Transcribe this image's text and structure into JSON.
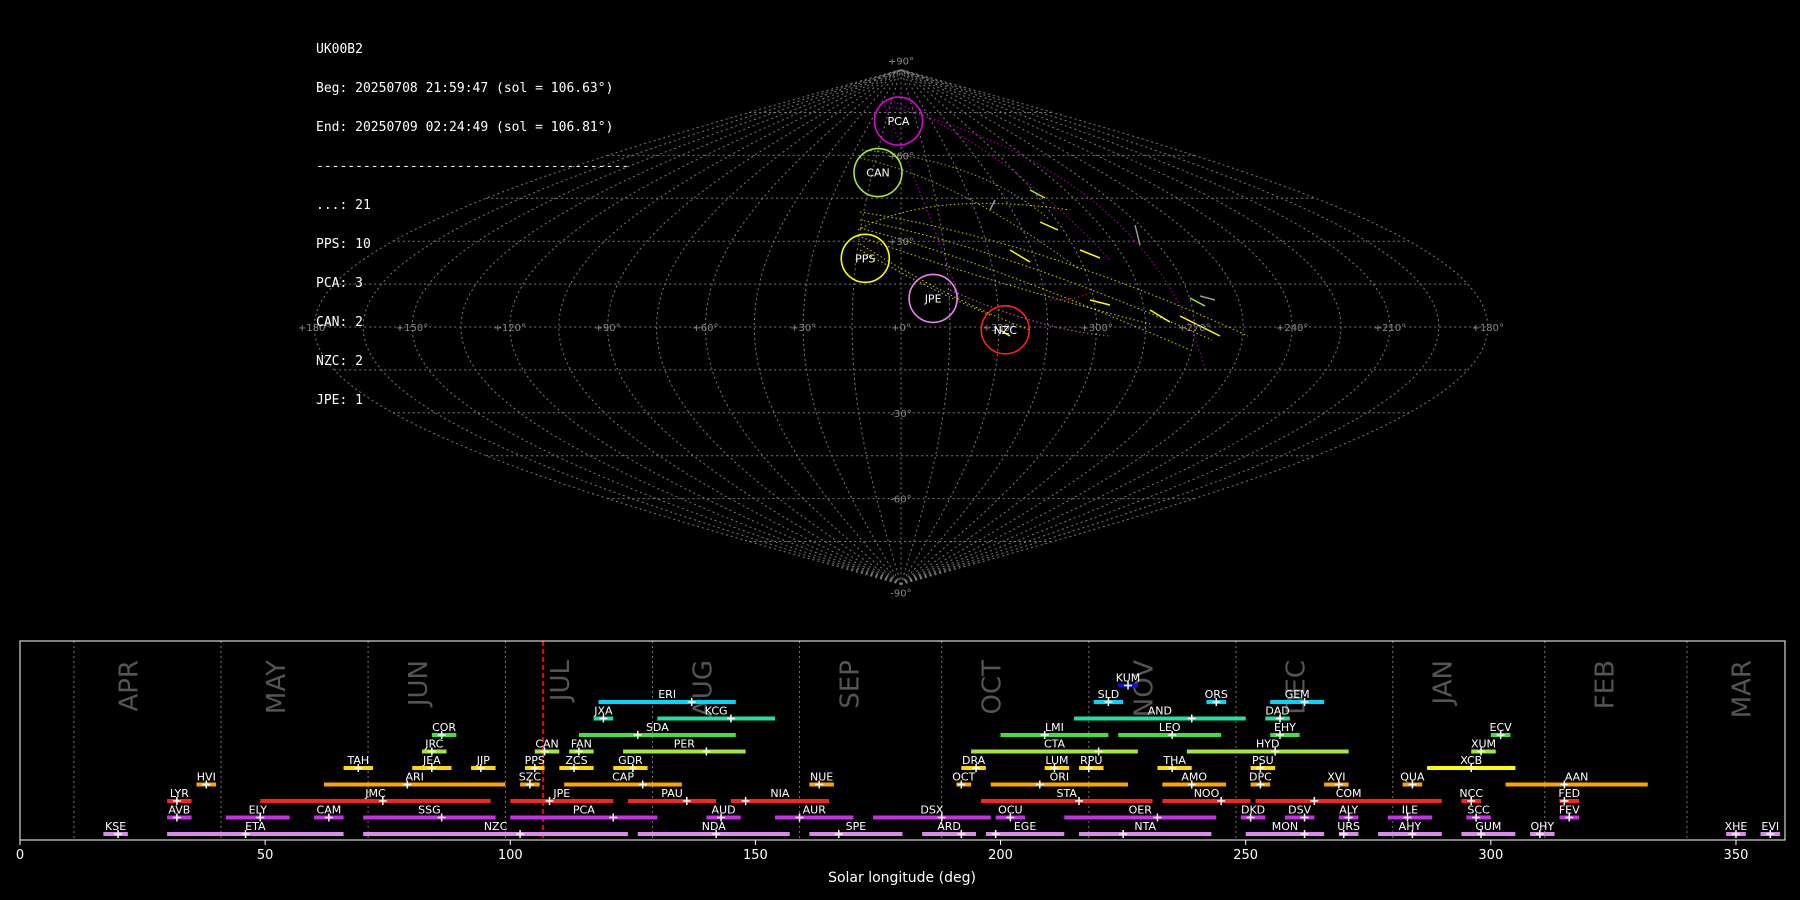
{
  "info": {
    "camera": "UK00B2",
    "beg": "Beg: 20250708 21:59:47 (sol = 106.63°)",
    "end": "End: 20250709 02:24:49 (sol = 106.81°)",
    "divider": "----------------------------------------",
    "counts": [
      "...: 21",
      "PPS: 10",
      "PCA: 3",
      "CAN: 2",
      "NZC: 2",
      "JPE: 1"
    ]
  },
  "sky_map": {
    "projection": "sinusoidal",
    "lon_labels": [
      "+180°",
      "+150°",
      "+120°",
      "+90°",
      "+60°",
      "+30°",
      "+0°",
      "+330°",
      "+300°",
      "+270°",
      "+240°",
      "+210°",
      "+180°"
    ],
    "lat_labels": [
      "+90°",
      "+60°",
      "+30°",
      "-30°",
      "-60°",
      "-90°"
    ],
    "radiants": [
      {
        "code": "PCA",
        "color": "#e000e0",
        "x": -2.5,
        "y": 72
      },
      {
        "code": "CAN",
        "color": "#a4e640",
        "x": -12,
        "y": 54
      },
      {
        "code": "PPS",
        "color": "#ffff00",
        "x": -12,
        "y": 24
      },
      {
        "code": "JPE",
        "color": "#ee82ee",
        "x": 10,
        "y": 10
      },
      {
        "code": "NZC",
        "color": "#ff2020",
        "x": 32,
        "y": -1
      }
    ]
  },
  "chart_data": {
    "type": "timeline",
    "xlabel": "Solar longitude (deg)",
    "xlim": [
      0,
      360
    ],
    "xticks": [
      0,
      50,
      100,
      150,
      200,
      250,
      300,
      350
    ],
    "current_sol": 106.7,
    "months": [
      {
        "label": "APR",
        "at": 24,
        "line": 11
      },
      {
        "label": "MAY",
        "at": 54,
        "line": 41
      },
      {
        "label": "JUN",
        "at": 83,
        "line": 71
      },
      {
        "label": "JUL",
        "at": 112,
        "line": 99
      },
      {
        "label": "AUG",
        "at": 141,
        "line": 129
      },
      {
        "label": "SEP",
        "at": 171,
        "line": 159
      },
      {
        "label": "OCT",
        "at": 200,
        "line": 188
      },
      {
        "label": "NOV",
        "at": 231,
        "line": 218
      },
      {
        "label": "DEC",
        "at": 262,
        "line": 248
      },
      {
        "label": "JAN",
        "at": 292,
        "line": 280
      },
      {
        "label": "FEB",
        "at": 325,
        "line": 311
      },
      {
        "label": "MAR",
        "at": 353,
        "line": 340
      }
    ],
    "showers": [
      {
        "code": "KUM",
        "s": 224,
        "e": 228,
        "p": 226,
        "row": 8,
        "c": "#1010e0"
      },
      {
        "code": "ERI",
        "s": 118,
        "e": 146,
        "p": 137,
        "row": 7,
        "c": "#00d4ff"
      },
      {
        "code": "SLD",
        "s": 219,
        "e": 225,
        "p": 222,
        "row": 7,
        "c": "#00d4ff"
      },
      {
        "code": "ORS",
        "s": 242,
        "e": 246,
        "p": 244,
        "row": 7,
        "c": "#00d4ff"
      },
      {
        "code": "GEM",
        "s": 255,
        "e": 266,
        "p": 262,
        "row": 7,
        "c": "#00d4ff"
      },
      {
        "code": "JXA",
        "s": 117,
        "e": 121,
        "p": 119,
        "row": 6,
        "c": "#20e0a0"
      },
      {
        "code": "KCG",
        "s": 130,
        "e": 154,
        "p": 145,
        "row": 6,
        "c": "#20e0a0"
      },
      {
        "code": "AND",
        "s": 215,
        "e": 250,
        "p": 239,
        "row": 6,
        "c": "#20e0a0"
      },
      {
        "code": "DAD",
        "s": 254,
        "e": 259,
        "p": 257,
        "row": 6,
        "c": "#20e0a0"
      },
      {
        "code": "COR",
        "s": 84,
        "e": 89,
        "p": 86,
        "row": 5,
        "c": "#40e040"
      },
      {
        "code": "SDA",
        "s": 114,
        "e": 146,
        "p": 126,
        "row": 5,
        "c": "#40e040"
      },
      {
        "code": "LMI",
        "s": 200,
        "e": 222,
        "p": 209,
        "row": 5,
        "c": "#40e040"
      },
      {
        "code": "LEO",
        "s": 224,
        "e": 245,
        "p": 235,
        "row": 5,
        "c": "#40e040"
      },
      {
        "code": "EHY",
        "s": 255,
        "e": 261,
        "p": 257,
        "row": 5,
        "c": "#40e040"
      },
      {
        "code": "ECV",
        "s": 300,
        "e": 304,
        "p": 302,
        "row": 5,
        "c": "#40e040"
      },
      {
        "code": "JRC",
        "s": 82,
        "e": 87,
        "p": 84,
        "row": 4,
        "c": "#a4e640"
      },
      {
        "code": "CAN",
        "s": 105,
        "e": 110,
        "p": 107,
        "row": 4,
        "c": "#a4e640"
      },
      {
        "code": "FAN",
        "s": 112,
        "e": 117,
        "p": 114,
        "row": 4,
        "c": "#a4e640"
      },
      {
        "code": "PER",
        "s": 123,
        "e": 148,
        "p": 140,
        "row": 4,
        "c": "#a4e640"
      },
      {
        "code": "CTA",
        "s": 194,
        "e": 228,
        "p": 220,
        "row": 4,
        "c": "#a4e640"
      },
      {
        "code": "HYD",
        "s": 238,
        "e": 271,
        "p": 256,
        "row": 4,
        "c": "#a4e640"
      },
      {
        "code": "XUM",
        "s": 296,
        "e": 301,
        "p": 298,
        "row": 4,
        "c": "#a4e640"
      },
      {
        "code": "TAH",
        "s": 66,
        "e": 72,
        "p": 69,
        "row": 3,
        "c": "#ffd700"
      },
      {
        "code": "JEA",
        "s": 80,
        "e": 88,
        "p": 84,
        "row": 3,
        "c": "#ffd700"
      },
      {
        "code": "JIP",
        "s": 92,
        "e": 97,
        "p": 94,
        "row": 3,
        "c": "#ffd700"
      },
      {
        "code": "PPS",
        "s": 103,
        "e": 107,
        "p": 105,
        "row": 3,
        "c": "#ffd700"
      },
      {
        "code": "ZCS",
        "s": 110,
        "e": 117,
        "p": 113,
        "row": 3,
        "c": "#ffd700"
      },
      {
        "code": "GDR",
        "s": 121,
        "e": 128,
        "p": 125,
        "row": 3,
        "c": "#ffd700"
      },
      {
        "code": "DRA",
        "s": 192,
        "e": 197,
        "p": 195,
        "row": 3,
        "c": "#ffd700"
      },
      {
        "code": "LUM",
        "s": 209,
        "e": 214,
        "p": 211,
        "row": 3,
        "c": "#ffd700"
      },
      {
        "code": "RPU",
        "s": 216,
        "e": 221,
        "p": 218,
        "row": 3,
        "c": "#ffd700"
      },
      {
        "code": "THA",
        "s": 232,
        "e": 239,
        "p": 235,
        "row": 3,
        "c": "#ffd700"
      },
      {
        "code": "PSU",
        "s": 251,
        "e": 256,
        "p": 253,
        "row": 3,
        "c": "#ffd700"
      },
      {
        "code": "XCB",
        "s": 287,
        "e": 305,
        "p": 296,
        "row": 3,
        "c": "#ffff00"
      },
      {
        "code": "HVI",
        "s": 36,
        "e": 40,
        "p": 38,
        "row": 2,
        "c": "#ffa500"
      },
      {
        "code": "ARI",
        "s": 62,
        "e": 99,
        "p": 79,
        "row": 2,
        "c": "#ffa500"
      },
      {
        "code": "SZC",
        "s": 102,
        "e": 106,
        "p": 104,
        "row": 2,
        "c": "#ffa500"
      },
      {
        "code": "CAP",
        "s": 111,
        "e": 135,
        "p": 127,
        "row": 2,
        "c": "#ffa500"
      },
      {
        "code": "NUE",
        "s": 161,
        "e": 166,
        "p": 163,
        "row": 2,
        "c": "#ffa500"
      },
      {
        "code": "OCT",
        "s": 191,
        "e": 194,
        "p": 192,
        "row": 2,
        "c": "#ffa500"
      },
      {
        "code": "ORI",
        "s": 198,
        "e": 226,
        "p": 208,
        "row": 2,
        "c": "#ffa500"
      },
      {
        "code": "AMO",
        "s": 233,
        "e": 246,
        "p": 239,
        "row": 2,
        "c": "#ffa500"
      },
      {
        "code": "DPC",
        "s": 251,
        "e": 255,
        "p": 253,
        "row": 2,
        "c": "#ffa500"
      },
      {
        "code": "XVI",
        "s": 266,
        "e": 271,
        "p": 269,
        "row": 2,
        "c": "#ffa500"
      },
      {
        "code": "QUA",
        "s": 282,
        "e": 286,
        "p": 284,
        "row": 2,
        "c": "#ffa500"
      },
      {
        "code": "AAN",
        "s": 303,
        "e": 332,
        "p": 315,
        "row": 2,
        "c": "#ffa500"
      },
      {
        "code": "LYR",
        "s": 30,
        "e": 35,
        "p": 32,
        "row": 1,
        "c": "#ff2020"
      },
      {
        "code": "JMC",
        "s": 49,
        "e": 96,
        "p": 74,
        "row": 1,
        "c": "#ff2020"
      },
      {
        "code": "JPE",
        "s": 100,
        "e": 121,
        "p": 108,
        "row": 1,
        "c": "#ff2020"
      },
      {
        "code": "PAU",
        "s": 124,
        "e": 142,
        "p": 136,
        "row": 1,
        "c": "#ff2020"
      },
      {
        "code": "NIA",
        "s": 145,
        "e": 165,
        "p": 148,
        "row": 1,
        "c": "#ff2020"
      },
      {
        "code": "STA",
        "s": 196,
        "e": 231,
        "p": 216,
        "row": 1,
        "c": "#ff2020"
      },
      {
        "code": "NOO",
        "s": 233,
        "e": 251,
        "p": 245,
        "row": 1,
        "c": "#ff2020"
      },
      {
        "code": "COM",
        "s": 252,
        "e": 290,
        "p": 264,
        "row": 1,
        "c": "#ff2020"
      },
      {
        "code": "NCC",
        "s": 294,
        "e": 298,
        "p": 296,
        "row": 1,
        "c": "#ff2020"
      },
      {
        "code": "FED",
        "s": 314,
        "e": 318,
        "p": 315,
        "row": 1,
        "c": "#ff2020"
      },
      {
        "code": "AVB",
        "s": 30,
        "e": 35,
        "p": 32,
        "row": 0,
        "c": "#c830e8"
      },
      {
        "code": "ELY",
        "s": 42,
        "e": 55,
        "p": 49,
        "row": 0,
        "c": "#c830e8"
      },
      {
        "code": "CAM",
        "s": 60,
        "e": 66,
        "p": 63,
        "row": 0,
        "c": "#c830e8"
      },
      {
        "code": "SSG",
        "s": 70,
        "e": 97,
        "p": 86,
        "row": 0,
        "c": "#c830e8"
      },
      {
        "code": "PCA",
        "s": 100,
        "e": 130,
        "p": 121,
        "row": 0,
        "c": "#c830e8"
      },
      {
        "code": "AUD",
        "s": 140,
        "e": 147,
        "p": 143,
        "row": 0,
        "c": "#c830e8"
      },
      {
        "code": "AUR",
        "s": 154,
        "e": 170,
        "p": 159,
        "row": 0,
        "c": "#c830e8"
      },
      {
        "code": "DSX",
        "s": 174,
        "e": 198,
        "p": 188,
        "row": 0,
        "c": "#c830e8"
      },
      {
        "code": "OCU",
        "s": 199,
        "e": 205,
        "p": 202,
        "row": 0,
        "c": "#c830e8"
      },
      {
        "code": "OER",
        "s": 213,
        "e": 244,
        "p": 232,
        "row": 0,
        "c": "#c830e8"
      },
      {
        "code": "DKD",
        "s": 249,
        "e": 254,
        "p": 251,
        "row": 0,
        "c": "#c830e8"
      },
      {
        "code": "DSV",
        "s": 258,
        "e": 264,
        "p": 262,
        "row": 0,
        "c": "#c830e8"
      },
      {
        "code": "ALY",
        "s": 269,
        "e": 273,
        "p": 271,
        "row": 0,
        "c": "#c830e8"
      },
      {
        "code": "ILE",
        "s": 279,
        "e": 288,
        "p": 283,
        "row": 0,
        "c": "#c830e8"
      },
      {
        "code": "SCC",
        "s": 295,
        "e": 300,
        "p": 297,
        "row": 0,
        "c": "#c830e8"
      },
      {
        "code": "FEV",
        "s": 314,
        "e": 318,
        "p": 316,
        "row": 0,
        "c": "#c830e8"
      },
      {
        "code": "KSE",
        "s": 17,
        "e": 22,
        "p": 20,
        "row": -1,
        "c": "#dd88ee"
      },
      {
        "code": "ETA",
        "s": 30,
        "e": 66,
        "p": 46,
        "row": -1,
        "c": "#dd88ee"
      },
      {
        "code": "NZC",
        "s": 70,
        "e": 124,
        "p": 102,
        "row": -1,
        "c": "#dd88ee"
      },
      {
        "code": "NDA",
        "s": 126,
        "e": 157,
        "p": 142,
        "row": -1,
        "c": "#dd88ee"
      },
      {
        "code": "SPE",
        "s": 161,
        "e": 180,
        "p": 167,
        "row": -1,
        "c": "#dd88ee"
      },
      {
        "code": "ARD",
        "s": 184,
        "e": 195,
        "p": 192,
        "row": -1,
        "c": "#dd88ee"
      },
      {
        "code": "EGE",
        "s": 197,
        "e": 213,
        "p": 199,
        "row": -1,
        "c": "#dd88ee"
      },
      {
        "code": "NTA",
        "s": 216,
        "e": 243,
        "p": 225,
        "row": -1,
        "c": "#dd88ee"
      },
      {
        "code": "MON",
        "s": 250,
        "e": 266,
        "p": 262,
        "row": -1,
        "c": "#dd88ee"
      },
      {
        "code": "URS",
        "s": 269,
        "e": 273,
        "p": 270,
        "row": -1,
        "c": "#dd88ee"
      },
      {
        "code": "AHY",
        "s": 277,
        "e": 290,
        "p": 284,
        "row": -1,
        "c": "#dd88ee"
      },
      {
        "code": "GUM",
        "s": 294,
        "e": 305,
        "p": 298,
        "row": -1,
        "c": "#dd88ee"
      },
      {
        "code": "OHY",
        "s": 308,
        "e": 313,
        "p": 310,
        "row": -1,
        "c": "#dd88ee"
      },
      {
        "code": "XHE",
        "s": 348,
        "e": 352,
        "p": 350,
        "row": -1,
        "c": "#dd88ee"
      },
      {
        "code": "EVI",
        "s": 355,
        "e": 359,
        "p": 357,
        "row": -1,
        "c": "#dd88ee"
      }
    ]
  }
}
